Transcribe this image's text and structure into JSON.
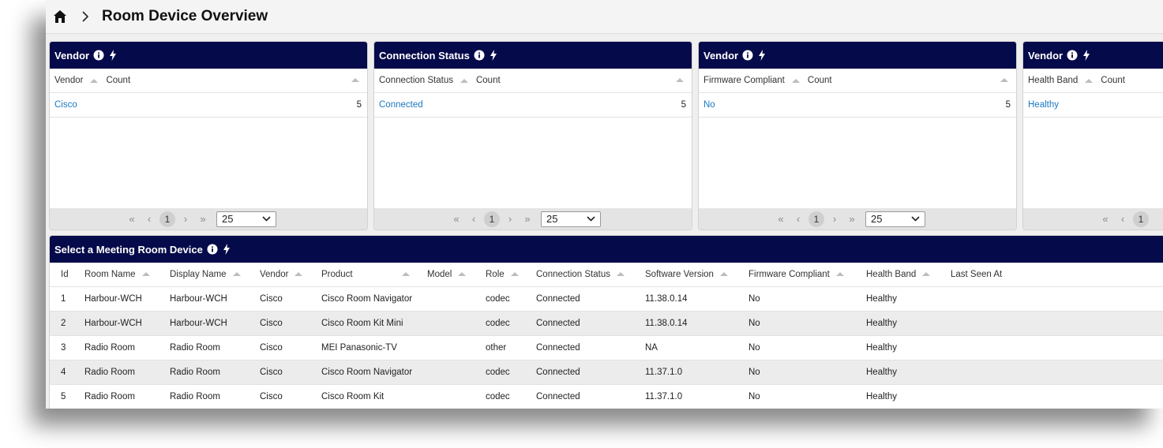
{
  "header": {
    "title": "Room Device Overview"
  },
  "panels": [
    {
      "title": "Vendor",
      "col1": "Vendor",
      "col2": "Count",
      "row": {
        "label": "Cisco",
        "count": "5"
      },
      "pager": {
        "first": "«",
        "prev": "‹",
        "page": "1",
        "next": "›",
        "last": "»",
        "size": "25"
      }
    },
    {
      "title": "Connection Status",
      "col1": "Connection Status",
      "col2": "Count",
      "row": {
        "label": "Connected",
        "count": "5"
      },
      "pager": {
        "first": "«",
        "prev": "‹",
        "page": "1",
        "next": "›",
        "last": "»",
        "size": "25"
      }
    },
    {
      "title": "Vendor",
      "col1": "Firmware Compliant",
      "col2": "Count",
      "row": {
        "label": "No",
        "count": "5"
      },
      "pager": {
        "first": "«",
        "prev": "‹",
        "page": "1",
        "next": "›",
        "last": "»",
        "size": "25"
      }
    },
    {
      "title": "Vendor",
      "col1": "Health Band",
      "col2": "Count",
      "row": {
        "label": "Healthy",
        "count": ""
      },
      "pager": {
        "first": "«",
        "prev": "‹",
        "page": "1"
      }
    }
  ],
  "grid": {
    "title": "Select a Meeting Room Device",
    "columns": [
      "Id",
      "Room Name",
      "Display Name",
      "Vendor",
      "Product",
      "Model",
      "Role",
      "Connection Status",
      "Software Version",
      "Firmware Compliant",
      "Health Band",
      "Last Seen At"
    ],
    "rows": [
      [
        "1",
        "Harbour-WCH",
        "Harbour-WCH",
        "Cisco",
        "Cisco Room Navigator",
        "",
        "codec",
        "Connected",
        "11.38.0.14",
        "No",
        "Healthy",
        ""
      ],
      [
        "2",
        "Harbour-WCH",
        "Harbour-WCH",
        "Cisco",
        "Cisco Room Kit Mini",
        "",
        "codec",
        "Connected",
        "11.38.0.14",
        "No",
        "Healthy",
        ""
      ],
      [
        "3",
        "Radio Room",
        "Radio Room",
        "Cisco",
        "MEI Panasonic-TV",
        "",
        "other",
        "Connected",
        "NA",
        "No",
        "Healthy",
        ""
      ],
      [
        "4",
        "Radio Room",
        "Radio Room",
        "Cisco",
        "Cisco Room Navigator",
        "",
        "codec",
        "Connected",
        "11.37.1.0",
        "No",
        "Healthy",
        ""
      ],
      [
        "5",
        "Radio Room",
        "Radio Room",
        "Cisco",
        "Cisco Room Kit",
        "",
        "codec",
        "Connected",
        "11.37.1.0",
        "No",
        "Healthy",
        ""
      ]
    ]
  },
  "icons": {
    "home": "home-icon",
    "info": "info-icon",
    "bolt": "bolt-icon",
    "sort": "sort-asc-icon",
    "chevron": "chevron-down-icon"
  },
  "colors": {
    "panel_header": "#050a4a",
    "link": "#1a78c2",
    "alt_row": "#ececec"
  }
}
